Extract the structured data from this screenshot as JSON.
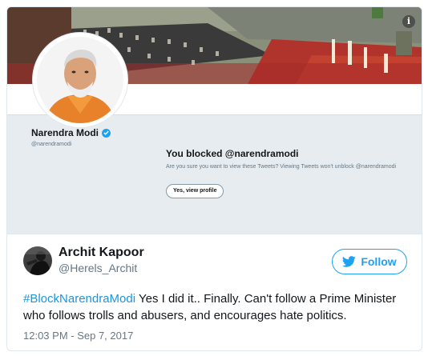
{
  "blocked_profile": {
    "name": "Narendra Modi",
    "handle": "@narendramodi",
    "blocked_title": "You blocked @narendramodi",
    "blocked_message": "Are you sure you want to view these Tweets? Viewing Tweets won't unblock @narendramodi",
    "view_profile_label": "Yes, view profile",
    "info_icon": "i"
  },
  "tweet": {
    "author_name": "Archit Kapoor",
    "author_handle": "@Herels_Archit",
    "follow_label": "Follow",
    "hashtag": "#BlockNarendraModi",
    "text": " Yes I did it.. Finally. Can't follow a Prime Minister who follows trolls and abusers, and encourages hate politics.",
    "timestamp": "12:03 PM - Sep 7, 2017"
  },
  "colors": {
    "accent": "#1da1f2",
    "hashtag": "#1b95e0",
    "secondary_text": "#657786",
    "panel_bg": "#e6ecf0",
    "verified": "#1da1f2"
  },
  "icons": {
    "verified": "verified-badge-icon",
    "follow": "twitter-bird-icon",
    "info": "info-icon"
  }
}
